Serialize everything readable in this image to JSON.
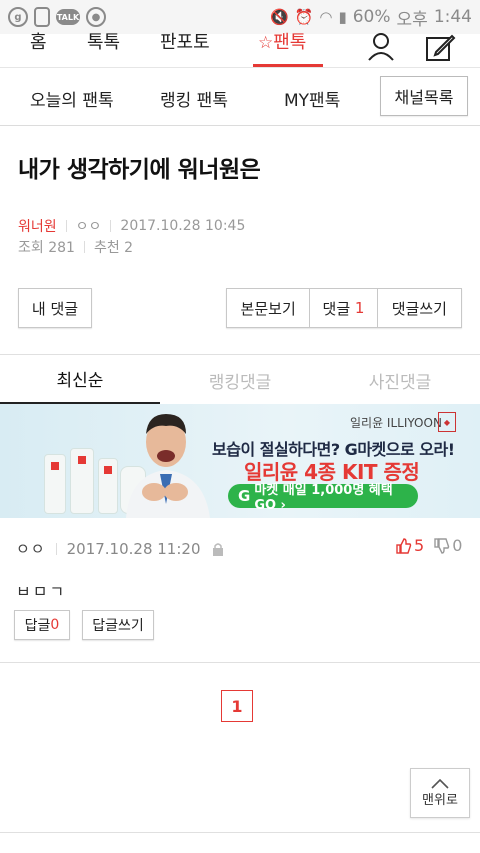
{
  "statusbar": {
    "icons_left": [
      "g-app-icon",
      "phone-icon",
      "talk-icon",
      "notification-icon"
    ],
    "talk_label": "TALK",
    "g_label": "g",
    "battery": "60%",
    "ampm": "오후",
    "time": "1:44"
  },
  "topnav": {
    "home": "홈",
    "dokdok": "톡톡",
    "panpoto": "판포토",
    "pantok": "팬톡"
  },
  "subnav": {
    "today": "오늘의 팬톡",
    "ranking": "랭킹 팬톡",
    "my": "MY팬톡",
    "channel_list": "채널목록"
  },
  "post": {
    "title": "내가 생각하기에 워너원은",
    "channel": "워너원",
    "author": "ㅇㅇ",
    "datetime": "2017.10.28 10:45",
    "views_label": "조회 281",
    "recommend_label": "추천 2"
  },
  "actions": {
    "my_comment": "내 댓글",
    "view_body": "본문보기",
    "comment_label": "댓글",
    "comment_count": "1",
    "write_comment": "댓글쓰기"
  },
  "tabs": {
    "newest": "최신순",
    "ranking": "랭킹댓글",
    "photo": "사진댓글"
  },
  "ad": {
    "brand": "일리윤 ILLIYOON",
    "seal": "一理潤",
    "line1": "보습이 절실하다면? G마켓으로 오라!",
    "line2": "일리윤 4종 KIT 증정",
    "gmarket_g": "G",
    "line3": "마켓 매일 1,000명 혜택 GO ›"
  },
  "comment": {
    "author": "ㅇㅇ",
    "datetime": "2017.10.28 11:20",
    "upvotes": "5",
    "downvotes": "0",
    "body": "ㅂㅁㄱ",
    "reply_label": "답글",
    "reply_count": "0",
    "reply_write": "답글쓰기"
  },
  "pagination": {
    "current": "1"
  },
  "to_top": {
    "label": "맨위로"
  },
  "colors": {
    "accent": "#e53935",
    "ad_green": "#2db34a"
  }
}
